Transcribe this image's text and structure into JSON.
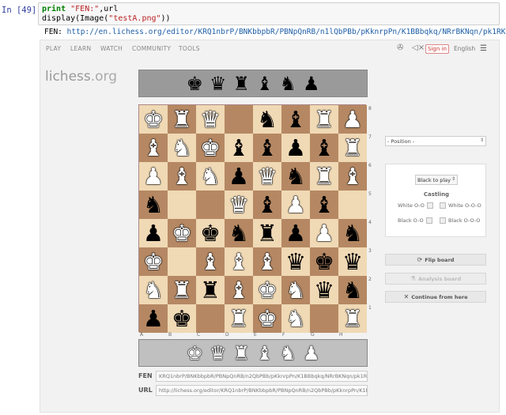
{
  "cell": {
    "prompt": "In [49]:",
    "code_line1_kw": "print",
    "code_line1_str": "\"FEN:\"",
    "code_line1_rest": ",url",
    "code_line2_pre": "display(Image(",
    "code_line2_str": "\"testA.png\"",
    "code_line2_post": "))",
    "output_label": "FEN:",
    "output_url": "http://en.lichess.org/editor/KRQ1nbrP/BNKbbpbR/PBNpQnRB/n1lQbPBb/pKknrpPn/K1BBbqkq/NRrBKNqn/pk1RKN1R"
  },
  "nav": {
    "items": [
      "PLAY",
      "LEARN",
      "WATCH",
      "COMMUNITY",
      "TOOLS"
    ],
    "signin": "Sign in",
    "language": "English",
    "icons": {
      "palette": "palette-icon",
      "sound": "sound-icon",
      "menu": "hamburger-menu-icon"
    }
  },
  "logo": {
    "main": "lichess",
    "suffix": ".org"
  },
  "spare_top": [
    "♚",
    "♛",
    "♜",
    "♝",
    "♞",
    "♟"
  ],
  "spare_bottom": [
    "♚",
    "♛",
    "♜",
    "♝",
    "♞",
    "♟"
  ],
  "board": [
    [
      "wK",
      "wR",
      "wQ",
      "",
      "bN",
      "bB",
      "wR",
      "wP"
    ],
    [
      "wB",
      "wN",
      "wK",
      "bB",
      "bB",
      "bP",
      "bB",
      "wR"
    ],
    [
      "wP",
      "wB",
      "wN",
      "bP",
      "wQ",
      "bN",
      "wR",
      "wB"
    ],
    [
      "bN",
      "",
      "",
      "wQ",
      "bB",
      "wP",
      "bB",
      ""
    ],
    [
      "bP",
      "wK",
      "bK",
      "bN",
      "bR",
      "bP",
      "wP",
      "bN"
    ],
    [
      "wK",
      "",
      "wB",
      "wB",
      "wB",
      "bQ",
      "bK",
      "bQ"
    ],
    [
      "wN",
      "wR",
      "bR",
      "wB",
      "wK",
      "wN",
      "bQ",
      "bN"
    ],
    [
      "bP",
      "bK",
      "",
      "wR",
      "wK",
      "wN",
      "",
      "wR"
    ]
  ],
  "ranks": [
    "8",
    "7",
    "6",
    "5",
    "4",
    "3",
    "2",
    "1"
  ],
  "files": [
    "A",
    "B",
    "C",
    "D",
    "E",
    "F",
    "G",
    "H"
  ],
  "fen_field": {
    "label": "FEN",
    "value": "KRQ1nbrP/BNKbbpbR/PBNpQnRB/n2QbPBb/pKknrpPn/K1BBbqkq/NRrBKNqn/pk1R"
  },
  "url_field": {
    "label": "URL",
    "value": "http://lichess.org/editor/KRQ1nbrP/BNKbbpbR/PBNpQnRB/n2QbPBb/pKknrpPn/K1BE"
  },
  "side": {
    "position_select": "- Position -",
    "turn_select": "Black to play",
    "castling_title": "Castling",
    "white_oo": "White O-O",
    "white_ooo": "White O-O-O",
    "black_oo": "Black O-O",
    "black_ooo": "Black O-O-O",
    "flip_board": "Flip board",
    "analysis_board": "Analysis board",
    "continue_from_here": "Continue from here"
  }
}
